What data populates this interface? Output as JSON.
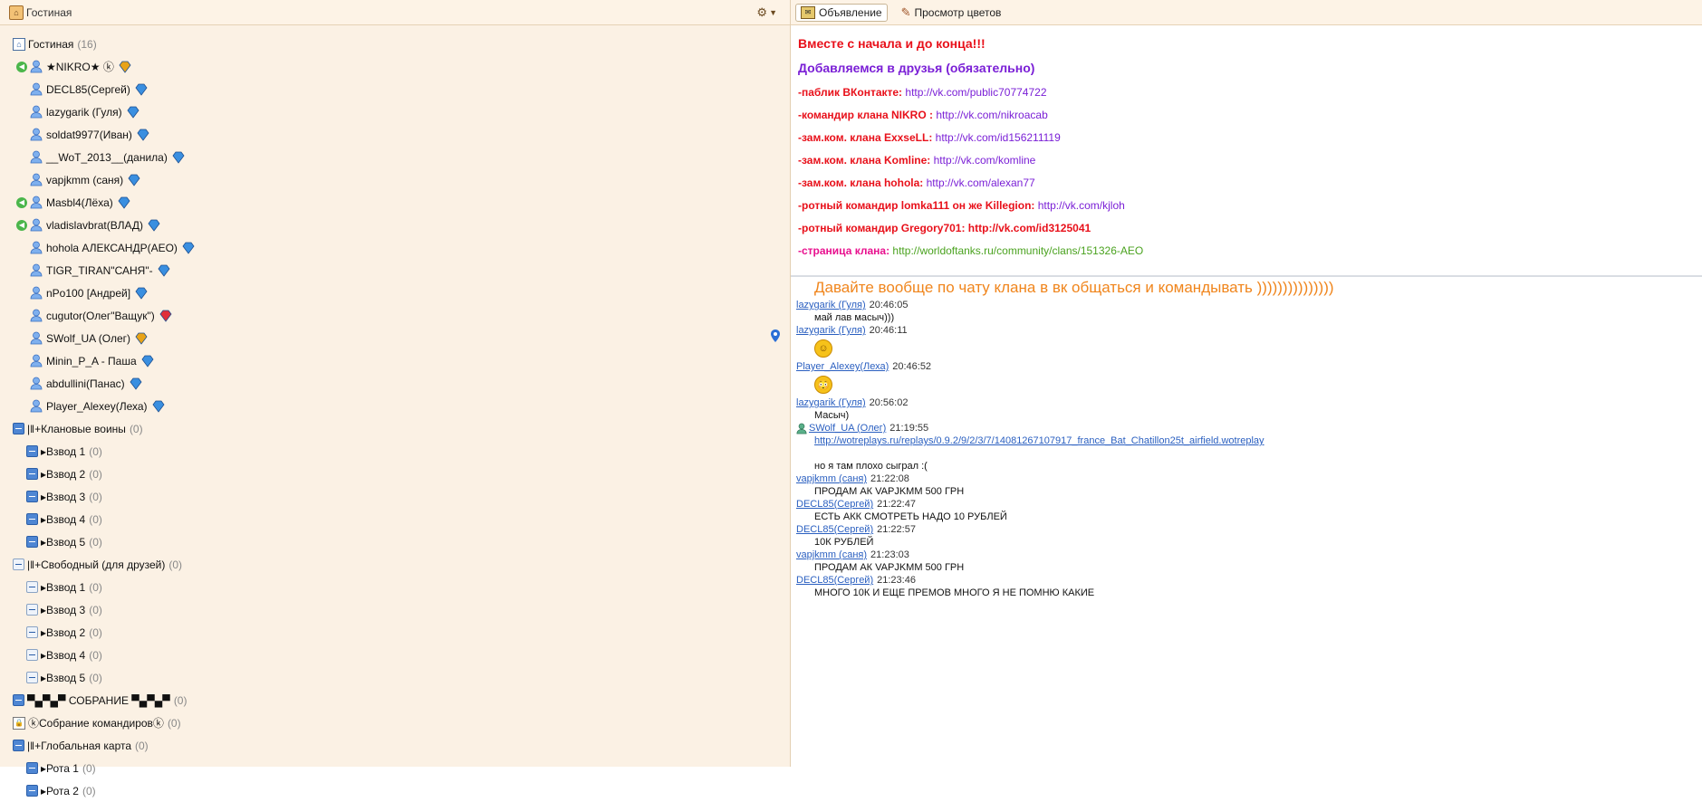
{
  "left_header": {
    "title": "Гостиная"
  },
  "right_header": {
    "tab_announcement": "Объявление",
    "tab_colors": "Просмотр цветов"
  },
  "tree": {
    "root": {
      "label": "Гостиная",
      "count": "(16)"
    },
    "users": [
      {
        "name": "★NIKRO★ ⓚ",
        "speaker": true,
        "badge": "crown"
      },
      {
        "name": "DECL85(Сергей)",
        "speaker": false,
        "badge": "diamond"
      },
      {
        "name": "lazygarik (Гуля)",
        "speaker": false,
        "badge": "diamond"
      },
      {
        "name": "soldat9977(Иван)",
        "speaker": false,
        "badge": "diamond"
      },
      {
        "name": "__WoT_2013__(данила)",
        "speaker": false,
        "badge": "diamond"
      },
      {
        "name": "vapjkmm (саня)",
        "speaker": false,
        "badge": "diamond"
      },
      {
        "name": "Masbl4(Лёха)",
        "speaker": true,
        "badge": "diamond"
      },
      {
        "name": "vladislavbrat(ВЛАД)",
        "speaker": true,
        "badge": "diamond"
      },
      {
        "name": "hohola АЛЕКСАНДР(AEO)",
        "speaker": false,
        "badge": "diamond"
      },
      {
        "name": "TIGR_TIRAN\"САНЯ\"-",
        "speaker": false,
        "badge": "diamond"
      },
      {
        "name": "nPo100 [Андрей]",
        "speaker": false,
        "badge": "diamond"
      },
      {
        "name": "cugutor(Олег\"Ващук\")",
        "speaker": false,
        "badge": "heart"
      },
      {
        "name": "SWolf_UA (Олег)",
        "speaker": false,
        "badge": "crown"
      },
      {
        "name": "Minin_P_A - Паша",
        "speaker": false,
        "badge": "diamond"
      },
      {
        "name": "abdullini(Панас)",
        "speaker": false,
        "badge": "diamond"
      },
      {
        "name": "Player_Alexey(Леха)",
        "speaker": false,
        "badge": "diamond"
      }
    ],
    "channels": [
      {
        "label": "|‖+Клановые воины",
        "count": "(0)",
        "level": 0,
        "style": "blue"
      },
      {
        "label": "▸Взвод 1",
        "count": "(0)",
        "level": 1,
        "style": "blue"
      },
      {
        "label": "▸Взвод 2",
        "count": "(0)",
        "level": 1,
        "style": "blue"
      },
      {
        "label": "▸Взвод 3",
        "count": "(0)",
        "level": 1,
        "style": "blue"
      },
      {
        "label": "▸Взвод 4",
        "count": "(0)",
        "level": 1,
        "style": "blue"
      },
      {
        "label": "▸Взвод 5",
        "count": "(0)",
        "level": 1,
        "style": "blue"
      },
      {
        "label": "|‖+Свободный (для друзей)",
        "count": "(0)",
        "level": 0,
        "style": "plain"
      },
      {
        "label": "▸Взвод 1",
        "count": "(0)",
        "level": 1,
        "style": "plain"
      },
      {
        "label": "▸Взвод 3",
        "count": "(0)",
        "level": 1,
        "style": "plain"
      },
      {
        "label": "▸Взвод 2",
        "count": "(0)",
        "level": 1,
        "style": "plain"
      },
      {
        "label": "▸Взвод 4",
        "count": "(0)",
        "level": 1,
        "style": "plain"
      },
      {
        "label": "▸Взвод 5",
        "count": "(0)",
        "level": 1,
        "style": "plain"
      },
      {
        "label": "▀▄▀▄▀ СОБРАНИЕ ▀▄▀▄▀",
        "count": "(0)",
        "level": 0,
        "style": "blue"
      },
      {
        "label": "ⓚСобрание командировⓚ",
        "count": "(0)",
        "level": 0,
        "style": "lock"
      },
      {
        "label": "|‖+Глобальная карта",
        "count": "(0)",
        "level": 0,
        "style": "blue"
      },
      {
        "label": "▸Рота 1",
        "count": "(0)",
        "level": 1,
        "style": "blue"
      },
      {
        "label": "▸Рота 2",
        "count": "(0)",
        "level": 1,
        "style": "blue"
      }
    ]
  },
  "announcement": [
    {
      "label": "Вместе с начала и до конца!!!",
      "link": "",
      "label_color": "#e8101a",
      "link_color": "",
      "size": 14,
      "bold": true
    },
    {
      "label": "Добавляемся в друзья (обязательно)",
      "link": "",
      "label_color": "#7a1fd6",
      "link_color": "",
      "size": 14,
      "bold": true
    },
    {
      "label": "-паблик ВКонтакте: ",
      "link": "http://vk.com/public70774722",
      "label_color": "#e8101a",
      "link_color": "#7a1fd6",
      "size": 12,
      "bold": true
    },
    {
      "label": "-командир клана NIKRO : ",
      "link": "http://vk.com/nikroacab",
      "label_color": "#e8101a",
      "link_color": "#7a1fd6",
      "size": 12,
      "bold": true
    },
    {
      "label": "-зам.ком. клана ExxseLL: ",
      "link": "http://vk.com/id156211119",
      "label_color": "#e8101a",
      "link_color": "#7a1fd6",
      "size": 12,
      "bold": true
    },
    {
      "label": "-зам.ком. клана Komline: ",
      "link": "http://vk.com/komline",
      "label_color": "#e8101a",
      "link_color": "#7a1fd6",
      "size": 12,
      "bold": true
    },
    {
      "label": "-зам.ком. клана hohola: ",
      "link": "http://vk.com/alexan77",
      "label_color": "#e8101a",
      "link_color": "#7a1fd6",
      "size": 12,
      "bold": true
    },
    {
      "label": "-ротный командир lomka111 он же Killegion: ",
      "link": "http://vk.com/kjloh",
      "label_color": "#e8101a",
      "link_color": "#7a1fd6",
      "size": 12,
      "bold": true
    },
    {
      "label": "-ротный командир Gregory701: http://vk.com/id3125041",
      "link": "",
      "label_color": "#e8101a",
      "link_color": "",
      "size": 12,
      "bold": true
    },
    {
      "label": "-страница клана: ",
      "link": "http://worldoftanks.ru/community/clans/151326-AEO",
      "label_color": "#e8108e",
      "link_color": "#4aa21f",
      "size": 12,
      "bold": true
    }
  ],
  "chat": {
    "banner": "Давайте вообще по чату клана в вк общаться и командывать  )))))))))))))))",
    "messages": [
      {
        "nick": "lazygarik (Гуля)",
        "time": "20:46:05",
        "text": "май лав масыч)))",
        "smile": "",
        "link": ""
      },
      {
        "nick": "lazygarik (Гуля)",
        "time": "20:46:11",
        "text": "",
        "smile": "☺",
        "link": ""
      },
      {
        "nick": "Player_Alexey(Леха)",
        "time": "20:46:52",
        "text": "",
        "smile": "😳",
        "link": ""
      },
      {
        "nick": "lazygarik (Гуля)",
        "time": "20:56:02",
        "text": "Масыч)",
        "smile": "",
        "link": ""
      },
      {
        "nick": "SWolf_UA (Олег)",
        "time": "21:19:55",
        "text": "но я там плохо сыграл :(",
        "smile": "",
        "link": "http://wotreplays.ru/replays/0.9.2/9/2/3/7/14081267107917_france_Bat_Chatillon25t_airfield.wotreplay"
      },
      {
        "nick": "vapjkmm (саня)",
        "time": "21:22:08",
        "text": "ПРОДАМ АК VAPJKMM 500 ГРН",
        "smile": "",
        "link": ""
      },
      {
        "nick": "DECL85(Сергей)",
        "time": "21:22:47",
        "text": "ЕСТЬ АКК СМОТРЕТЬ НАДО 10 РУБЛЕЙ",
        "smile": "",
        "link": ""
      },
      {
        "nick": "DECL85(Сергей)",
        "time": "21:22:57",
        "text": "10К РУБЛЕЙ",
        "smile": "",
        "link": ""
      },
      {
        "nick": "vapjkmm (саня)",
        "time": "21:23:03",
        "text": "ПРОДАМ АК VAPJKMM 500 ГРН",
        "smile": "",
        "link": ""
      },
      {
        "nick": "DECL85(Сергей)",
        "time": "21:23:46",
        "text": "МНОГО 10К И ЕЩЕ ПРЕМОВ МНОГО Я НЕ ПОМНЮ КАКИЕ",
        "smile": "",
        "link": ""
      }
    ]
  }
}
